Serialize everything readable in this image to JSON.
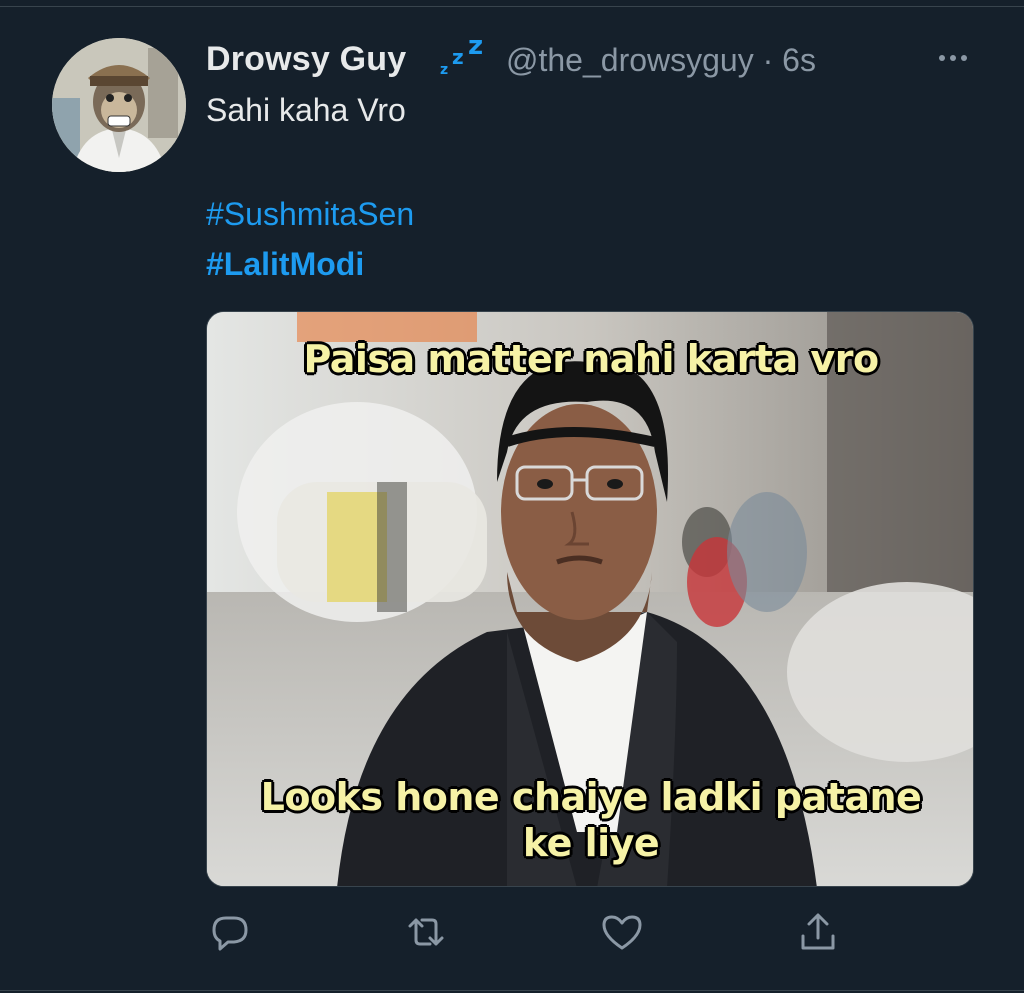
{
  "tweet": {
    "display_name": "Drowsy Guy",
    "handle": "@the_drowsyguy",
    "separator": " · ",
    "timestamp": "6s",
    "text": "Sahi kaha Vro",
    "hashtags": [
      "#SushmitaSen",
      "#LalitModi"
    ],
    "media": {
      "caption_top": "Paisa matter nahi karta vro",
      "caption_bottom": "Looks hone chaiye ladki patane ke liye"
    }
  },
  "icons": {
    "name_badge": "zzz-icon",
    "more": "more-horizontal-icon",
    "reply": "reply-icon",
    "retweet": "retweet-icon",
    "like": "heart-icon",
    "share": "share-icon"
  },
  "colors": {
    "background": "#15202b",
    "link": "#1d9bf0",
    "secondary_text": "#8b98a5",
    "caption": "#f6f2a6"
  }
}
